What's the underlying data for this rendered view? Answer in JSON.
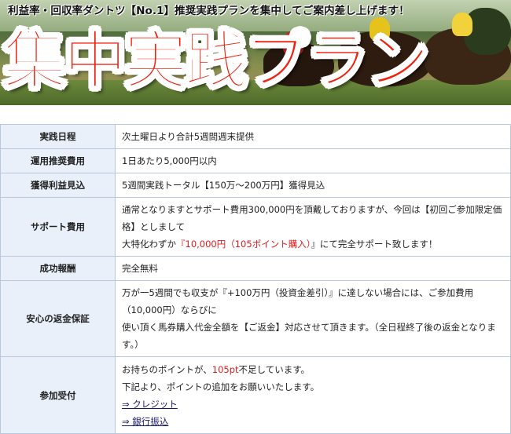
{
  "banner": {
    "tagline": "利益率・回収率ダントツ【No.1】推奨実践プランを集中してご案内差し上げます！",
    "title": "集中実践プラン"
  },
  "table": {
    "schedule": {
      "label": "実践日程",
      "value": "次土曜日より合計5週間週末提供"
    },
    "cost": {
      "label": "運用推奨費用",
      "value": "1日あたり5,000円以内"
    },
    "profit": {
      "label": "獲得利益見込",
      "value": "5週間実践トータル【150万〜200万円】獲得見込"
    },
    "support": {
      "label": "サポート費用",
      "line1": "通常となりますとサポート費用300,000円を頂戴しておりますが、今回は【初回ご参加限定価格】としまして",
      "line2_prefix": "大特化わずか",
      "line2_price": "『10,000円（105ポイント購入）",
      "line2_suffix": "』にて完全サポート致します！"
    },
    "reward": {
      "label": "成功報酬",
      "value": "完全無料"
    },
    "guarantee": {
      "label": "安心の返金保証",
      "line1": "万が一5週間でも収支が『+100万円（投資金差引）』に達しない場合には、ご参加費用（10,000円）ならびに",
      "line2": "使い頂く馬券購入代金全額を【ご返金】対応させて頂きます。（全日程終了後の返金となります。）"
    },
    "join": {
      "label": "参加受付",
      "line1_prefix": "お持ちのポイントが、",
      "line1_points": "105pt",
      "line1_suffix": "不足しています。",
      "line2": "下記より、ポイントの追加をお願いいたします。",
      "link_credit": "⇒ クレジット",
      "link_bank": "⇒ 銀行振込"
    }
  },
  "colors": {
    "title_red": "#f0210f",
    "label_bg": "#e9f0fa",
    "border": "#b9c8dd",
    "accent_red": "#e11b1b"
  }
}
